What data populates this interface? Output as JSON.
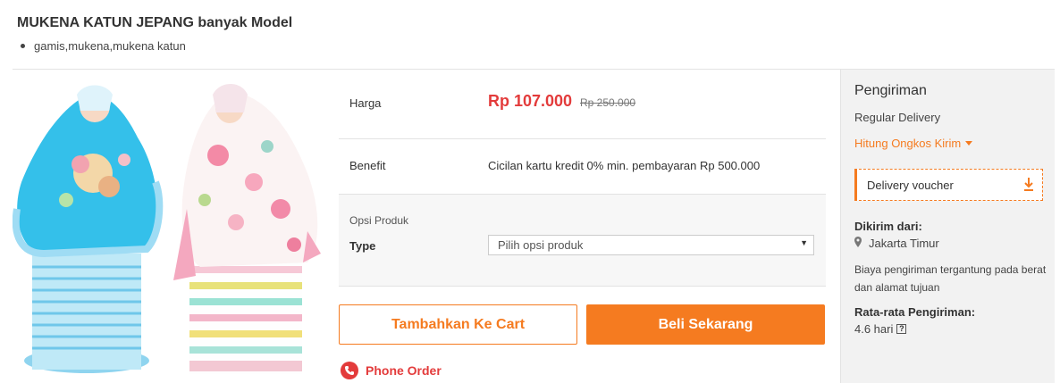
{
  "product": {
    "title": "MUKENA KATUN JEPANG banyak Model",
    "tags": "gamis,mukena,mukena katun"
  },
  "details": {
    "price_label": "Harga",
    "price_new": "Rp 107.000",
    "price_old": "Rp 250.000",
    "benefit_label": "Benefit",
    "benefit_value": "Cicilan kartu kredit 0% min. pembayaran Rp 500.000",
    "option_title": "Opsi Produk",
    "option_type_label": "Type",
    "option_select_value": "Pilih opsi produk"
  },
  "actions": {
    "cart_label": "Tambahkan Ke Cart",
    "buy_label": "Beli Sekarang",
    "phone_label": "Phone Order"
  },
  "shipping": {
    "title": "Pengiriman",
    "regular": "Regular Delivery",
    "calc_link": "Hitung Ongkos Kirim",
    "voucher": "Delivery voucher",
    "from_label": "Dikirim dari:",
    "from_value": "Jakarta Timur",
    "note": "Biaya pengiriman tergantung pada berat dan alamat tujuan",
    "avg_label": "Rata-rata Pengiriman:",
    "avg_value": "4.6 hari",
    "help_glyph": "?"
  },
  "colors": {
    "accent": "#f57b20",
    "price": "#e33b3b",
    "panel_bg": "#f2f2f2"
  },
  "icons": [
    "location-pin-icon",
    "download-icon",
    "phone-icon",
    "caret-down-icon",
    "help-icon"
  ]
}
